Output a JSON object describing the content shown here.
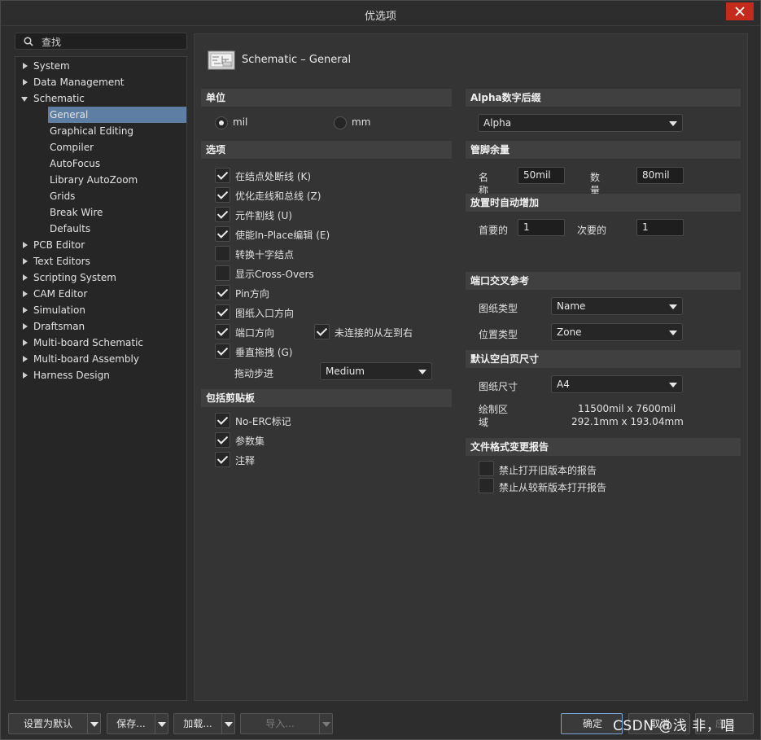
{
  "window": {
    "title": "优选项",
    "close_icon": "close-icon"
  },
  "search": {
    "placeholder": "查找",
    "icon": "search-icon"
  },
  "tree": {
    "items": [
      {
        "label": "System"
      },
      {
        "label": "Data Management"
      },
      {
        "label": "Schematic"
      },
      {
        "label": "General"
      },
      {
        "label": "Graphical Editing"
      },
      {
        "label": "Compiler"
      },
      {
        "label": "AutoFocus"
      },
      {
        "label": "Library AutoZoom"
      },
      {
        "label": "Grids"
      },
      {
        "label": "Break Wire"
      },
      {
        "label": "Defaults"
      },
      {
        "label": "PCB Editor"
      },
      {
        "label": "Text Editors"
      },
      {
        "label": "Scripting System"
      },
      {
        "label": "CAM Editor"
      },
      {
        "label": "Simulation"
      },
      {
        "label": "Draftsman"
      },
      {
        "label": "Multi-board Schematic"
      },
      {
        "label": "Multi-board Assembly"
      },
      {
        "label": "Harness Design"
      }
    ],
    "selected": "General"
  },
  "page": {
    "title": "Schematic – General"
  },
  "units": {
    "header": "单位",
    "mil_label": "mil",
    "mm_label": "mm",
    "selected": "mil"
  },
  "options": {
    "header": "选项",
    "items": [
      {
        "label": "在结点处断线 (K)",
        "checked": true
      },
      {
        "label": "优化走线和总线 (Z)",
        "checked": true
      },
      {
        "label": "元件割线 (U)",
        "checked": true
      },
      {
        "label": "使能In-Place编辑 (E)",
        "checked": true
      },
      {
        "label": "转换十字结点",
        "checked": false
      },
      {
        "label": "显示Cross-Overs",
        "checked": false
      },
      {
        "label": "Pin方向",
        "checked": true
      },
      {
        "label": "图纸入口方向",
        "checked": true
      },
      {
        "label": "端口方向",
        "checked": true
      },
      {
        "label": "垂直拖拽 (G)",
        "checked": true
      }
    ],
    "unconnected_label": "未连接的从左到右",
    "unconnected_checked": true,
    "drag_step_label": "拖动步进",
    "drag_step_value": "Medium"
  },
  "clipboard": {
    "header": "包括剪贴板",
    "items": [
      {
        "label": "No-ERC标记",
        "checked": true
      },
      {
        "label": "参数集",
        "checked": true
      },
      {
        "label": "注释",
        "checked": true
      }
    ]
  },
  "alpha": {
    "header": "Alpha数字后缀",
    "value": "Alpha"
  },
  "pin_margin": {
    "header": "管脚余量",
    "name_label": "名称",
    "name_value": "50mil",
    "number_label": "数量",
    "number_value": "80mil"
  },
  "auto_increment": {
    "header": "放置时自动增加",
    "primary_label": "首要的",
    "primary_value": "1",
    "secondary_label": "次要的",
    "secondary_value": "1"
  },
  "port_cross_ref": {
    "header": "端口交叉参考",
    "sheet_type_label": "图纸类型",
    "sheet_type_value": "Name",
    "location_type_label": "位置类型",
    "location_type_value": "Zone"
  },
  "default_blank_sheet": {
    "header": "默认空白页尺寸",
    "sheet_size_label": "图纸尺寸",
    "sheet_size_value": "A4",
    "draw_area_label": "绘制区域",
    "draw_area_mil": "11500mil x 7600mil",
    "draw_area_mm": "292.1mm x 193.04mm"
  },
  "file_format": {
    "header": "文件格式变更报告",
    "items": [
      {
        "label": "禁止打开旧版本的报告",
        "checked": false
      },
      {
        "label": "禁止从较新版本打开报告",
        "checked": false
      }
    ]
  },
  "footer": {
    "set_default": "设置为默认",
    "save": "保存...",
    "load": "加载...",
    "import": "导入...",
    "ok": "确定",
    "cancel": "取消",
    "apply": "应用"
  },
  "watermark": "CSDN @浅 非，唱",
  "colors": {
    "accent_selected": "#5e7fa3",
    "close": "#c42b1c",
    "panel": "#343434"
  }
}
